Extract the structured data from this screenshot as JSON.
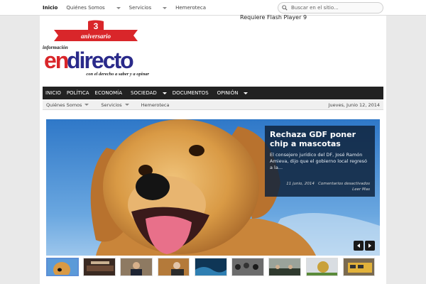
{
  "topnav": {
    "items": [
      "Inicio",
      "Quiénes Somos",
      "Servicios",
      "Hemeroteca"
    ],
    "search_placeholder": "Buscar en el sitio..."
  },
  "header": {
    "flash_notice": "Requiere Flash Player 9",
    "logo": {
      "number": "3",
      "ribbon": "aniversario",
      "kicker": "información",
      "wordmark_en": "en",
      "wordmark_directo": "directo",
      "tagline": "con el derecho a saber y a opinar"
    }
  },
  "mainnav": {
    "items": [
      "INICIO",
      "POLÍTICA",
      "ECONOMÍA",
      "SOCIEDAD",
      "DOCUMENTOS",
      "OPINIÓN"
    ]
  },
  "subnav": {
    "items": [
      "Quiénes Somos",
      "Servicios",
      "Hemeroteca"
    ],
    "date": "Jueves, Junio 12, 2014"
  },
  "slider": {
    "title": "Rechaza GDF poner chip a mascotas",
    "excerpt": "El consejero jurídico del DF, José Ramón Amieva, dijo que el gobierno local regresó a la...",
    "date": "11 junio, 2014",
    "comments": "Comentarios desactivados",
    "more": "Leer Mas"
  },
  "thumbnails": [
    "dog",
    "room",
    "speaker",
    "politician",
    "wave",
    "crowd",
    "meeting",
    "trophy",
    "bus"
  ],
  "colors": {
    "logo_red": "#d9262a",
    "logo_blue": "#2a2a8a",
    "caption_bg": "#0f233c",
    "nav_bg": "#222222"
  }
}
